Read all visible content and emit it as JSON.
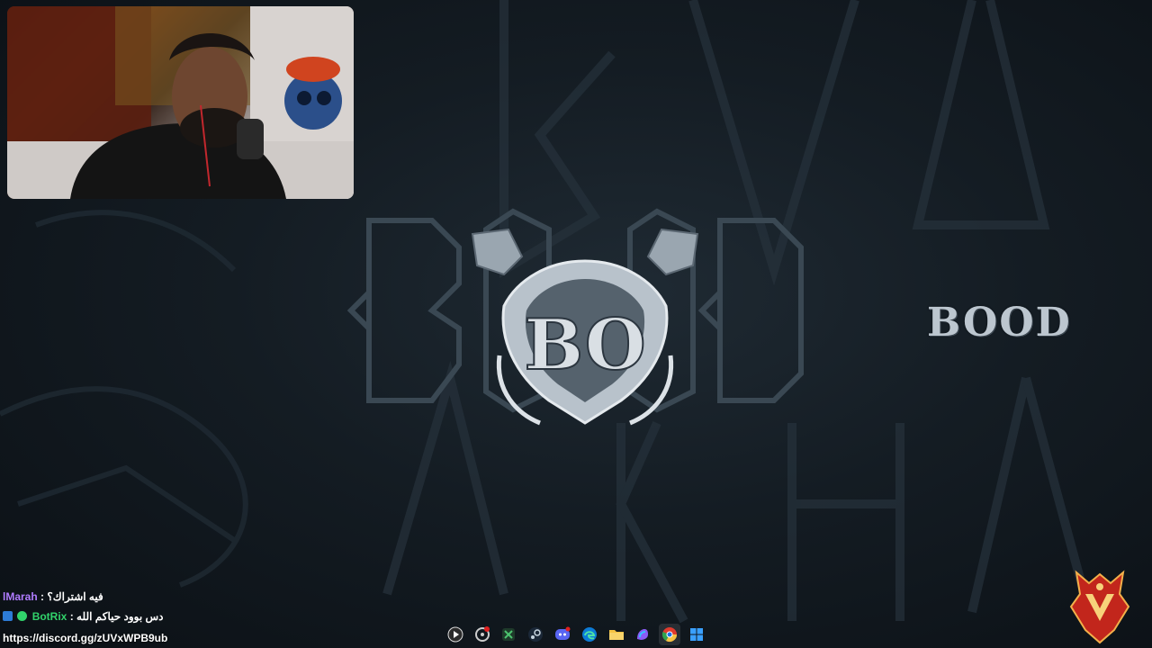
{
  "screen": {
    "background": "#141c23"
  },
  "webcam": {
    "label": "streamer webcam"
  },
  "branding": {
    "title": "BOOD",
    "accent": "#bcc6cf"
  },
  "chat": {
    "messages": [
      {
        "user": "lMarah",
        "separator": ":",
        "text": "فيه اشتراك؟",
        "user_color": "#b07cff"
      },
      {
        "user": "BotRix",
        "separator": ":",
        "text": "دس بوود حياكم الله",
        "user_color": "#31d36b"
      }
    ],
    "link": "https://discord.gg/zUVxWPB9ub"
  },
  "taskbar": {
    "apps": [
      {
        "name": "media-player-icon"
      },
      {
        "name": "steelseries-icon"
      },
      {
        "name": "xbox-icon"
      },
      {
        "name": "steam-icon"
      },
      {
        "name": "discord-icon"
      },
      {
        "name": "edge-icon"
      },
      {
        "name": "file-explorer-icon"
      },
      {
        "name": "copilot-icon"
      },
      {
        "name": "chrome-icon"
      },
      {
        "name": "windows-start-icon"
      }
    ]
  }
}
